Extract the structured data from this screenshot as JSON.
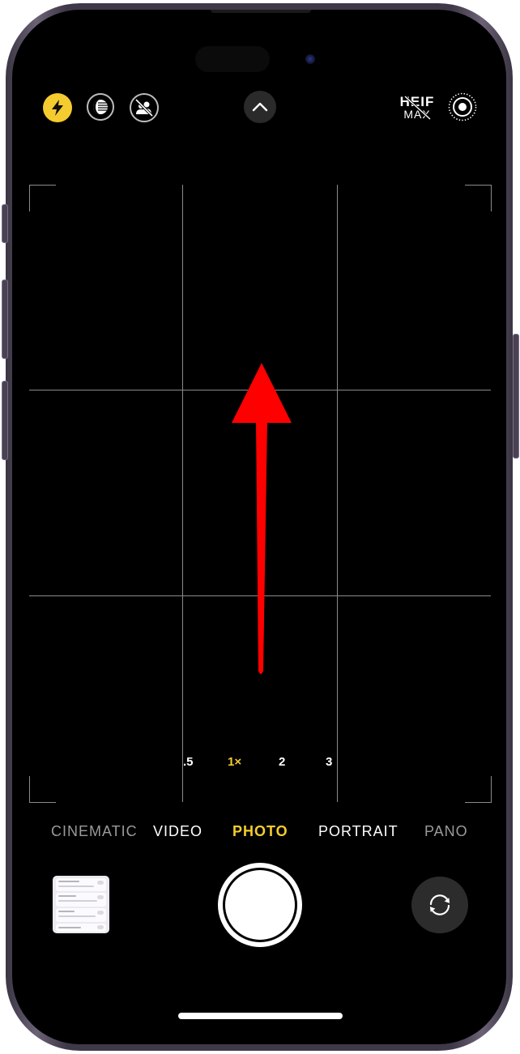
{
  "top_controls": {
    "flash": {
      "icon": "flash-icon",
      "state": "on",
      "color": "#f5cc2f"
    },
    "night_mode": {
      "icon": "night-mode-icon"
    },
    "live_off": {
      "icon": "live-photo-off-icon"
    },
    "expand": {
      "icon": "chevron-up-icon"
    },
    "format": {
      "line1": "HEIF",
      "line2": "MAX",
      "state": "off"
    },
    "live_photo": {
      "icon": "live-photo-icon"
    }
  },
  "zoom_options": [
    {
      "label": ".5",
      "active": false
    },
    {
      "label": "1×",
      "active": true
    },
    {
      "label": "2",
      "active": false
    },
    {
      "label": "3",
      "active": false
    }
  ],
  "modes": [
    {
      "label": "CINEMATIC",
      "active": false
    },
    {
      "label": "VIDEO",
      "active": false
    },
    {
      "label": "PHOTO",
      "active": true
    },
    {
      "label": "PORTRAIT",
      "active": false
    },
    {
      "label": "PANO",
      "active": false
    }
  ],
  "bottom_controls": {
    "thumbnail": {
      "icon": "last-photo-thumbnail"
    },
    "shutter": {
      "icon": "shutter-button"
    },
    "flip": {
      "icon": "camera-flip-icon"
    }
  },
  "annotation": {
    "type": "arrow",
    "direction": "up",
    "color": "#ff0000"
  },
  "colors": {
    "accent": "#f5cc2f",
    "background": "#000000",
    "frame": "#3f3848"
  }
}
